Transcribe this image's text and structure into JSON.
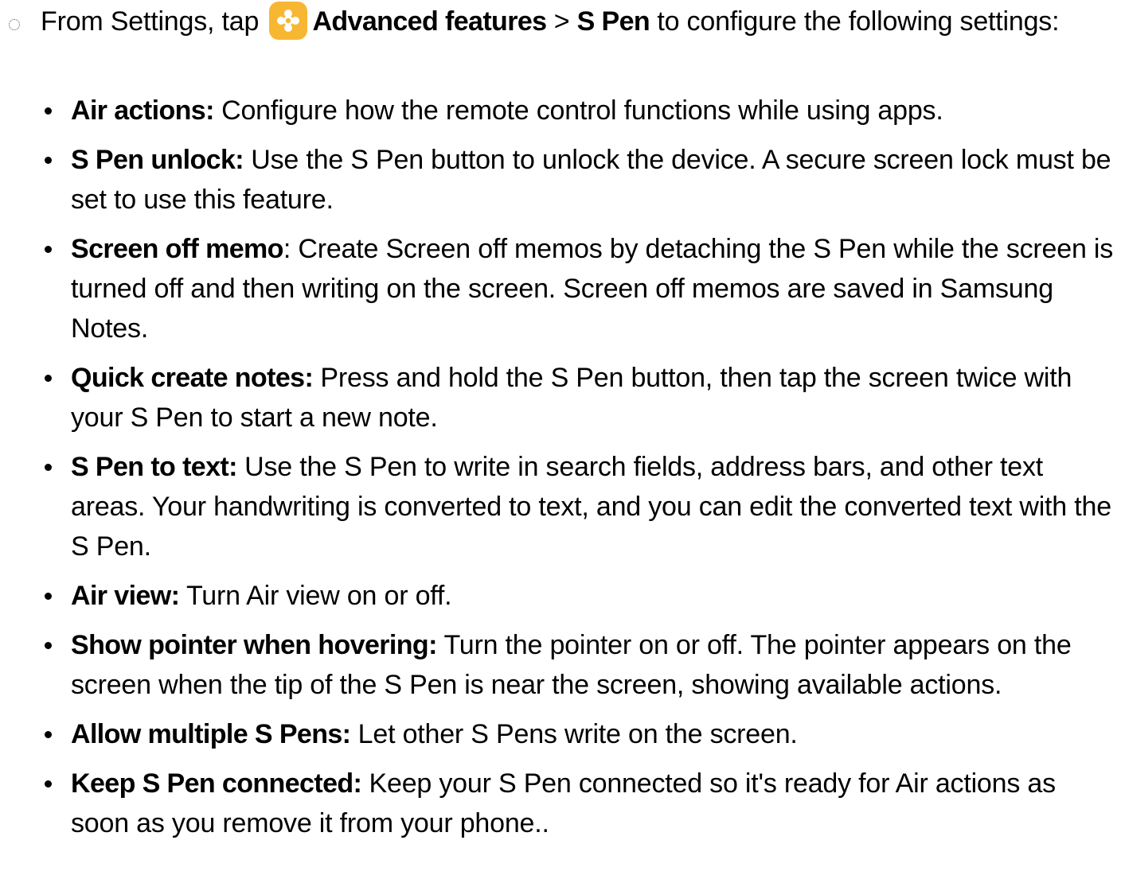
{
  "intro": {
    "prefix": "From Settings, tap ",
    "icon": "settings-gear-icon",
    "path_first": "Advanced features",
    "separator": " > ",
    "path_second": "S Pen",
    "suffix": " to configure the following settings:"
  },
  "items": [
    {
      "term": "Air actions:",
      "text": " Configure how the remote control functions while using apps."
    },
    {
      "term": "S Pen unlock:",
      "text": " Use the S Pen button to unlock the device. A secure screen lock must be set to use this feature."
    },
    {
      "term": "Screen off memo",
      "text": ": Create Screen off memos by detaching the S Pen while the screen is turned off and then writing on the screen. Screen off memos are saved in Samsung Notes."
    },
    {
      "term": "Quick create notes:",
      "text": " Press and hold the S Pen button, then tap the screen twice with your S Pen to start a new note."
    },
    {
      "term": "S Pen to text:",
      "text": " Use the S Pen to write in search fields, address bars, and other text areas. Your handwriting is converted to text, and you can edit the converted text with the S Pen."
    },
    {
      "term": "Air view:",
      "text": " Turn Air view on or off."
    },
    {
      "term": "Show pointer when hovering:",
      "text": " Turn the pointer on or off. The pointer appears on the screen when the tip of the S Pen is near the screen, showing available actions."
    },
    {
      "term": "Allow multiple S Pens:",
      "text": " Let other S Pens write on the screen."
    },
    {
      "term": "Keep S Pen connected:",
      "text": " Keep your S Pen connected so it's ready for Air actions as soon as you remove it from your phone.."
    }
  ],
  "colors": {
    "icon_background": "#f7b733",
    "text": "#000000"
  }
}
